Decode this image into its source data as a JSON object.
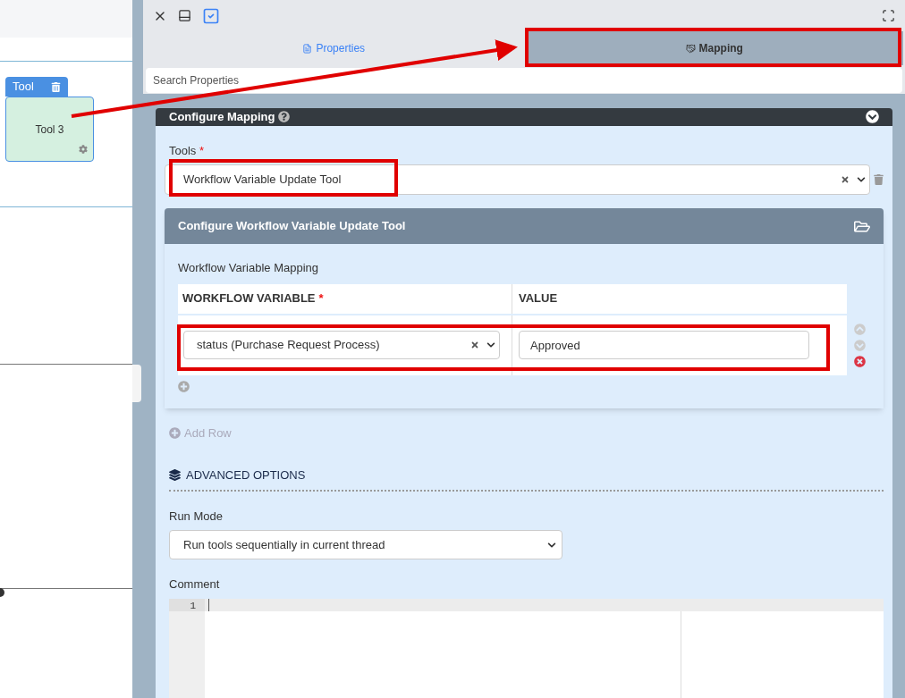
{
  "canvas": {
    "node": {
      "header": "Tool",
      "label": "Tool 3"
    }
  },
  "tabs": [
    {
      "label": "Properties",
      "selected": false
    },
    {
      "label": "Mapping",
      "selected": true
    }
  ],
  "search": {
    "placeholder": "Search Properties"
  },
  "configure_mapping": {
    "title": "Configure Mapping",
    "tools": {
      "label": "Tools",
      "required_mark": "*",
      "value": "Workflow Variable Update Tool"
    },
    "tool_panel": {
      "title": "Configure Workflow Variable Update Tool",
      "mapping_label": "Workflow Variable Mapping",
      "columns": [
        {
          "label": "WORKFLOW VARIABLE",
          "required_mark": "*"
        },
        {
          "label": "VALUE"
        }
      ],
      "rows": [
        {
          "variable": "status (Purchase Request Process)",
          "value": "Approved"
        }
      ]
    },
    "add_row": "Add Row",
    "advanced_options": "ADVANCED OPTIONS",
    "run_mode": {
      "label": "Run Mode",
      "value": "Run tools sequentially in current thread"
    },
    "comment": {
      "label": "Comment",
      "line_numbers": [
        "1"
      ]
    }
  }
}
